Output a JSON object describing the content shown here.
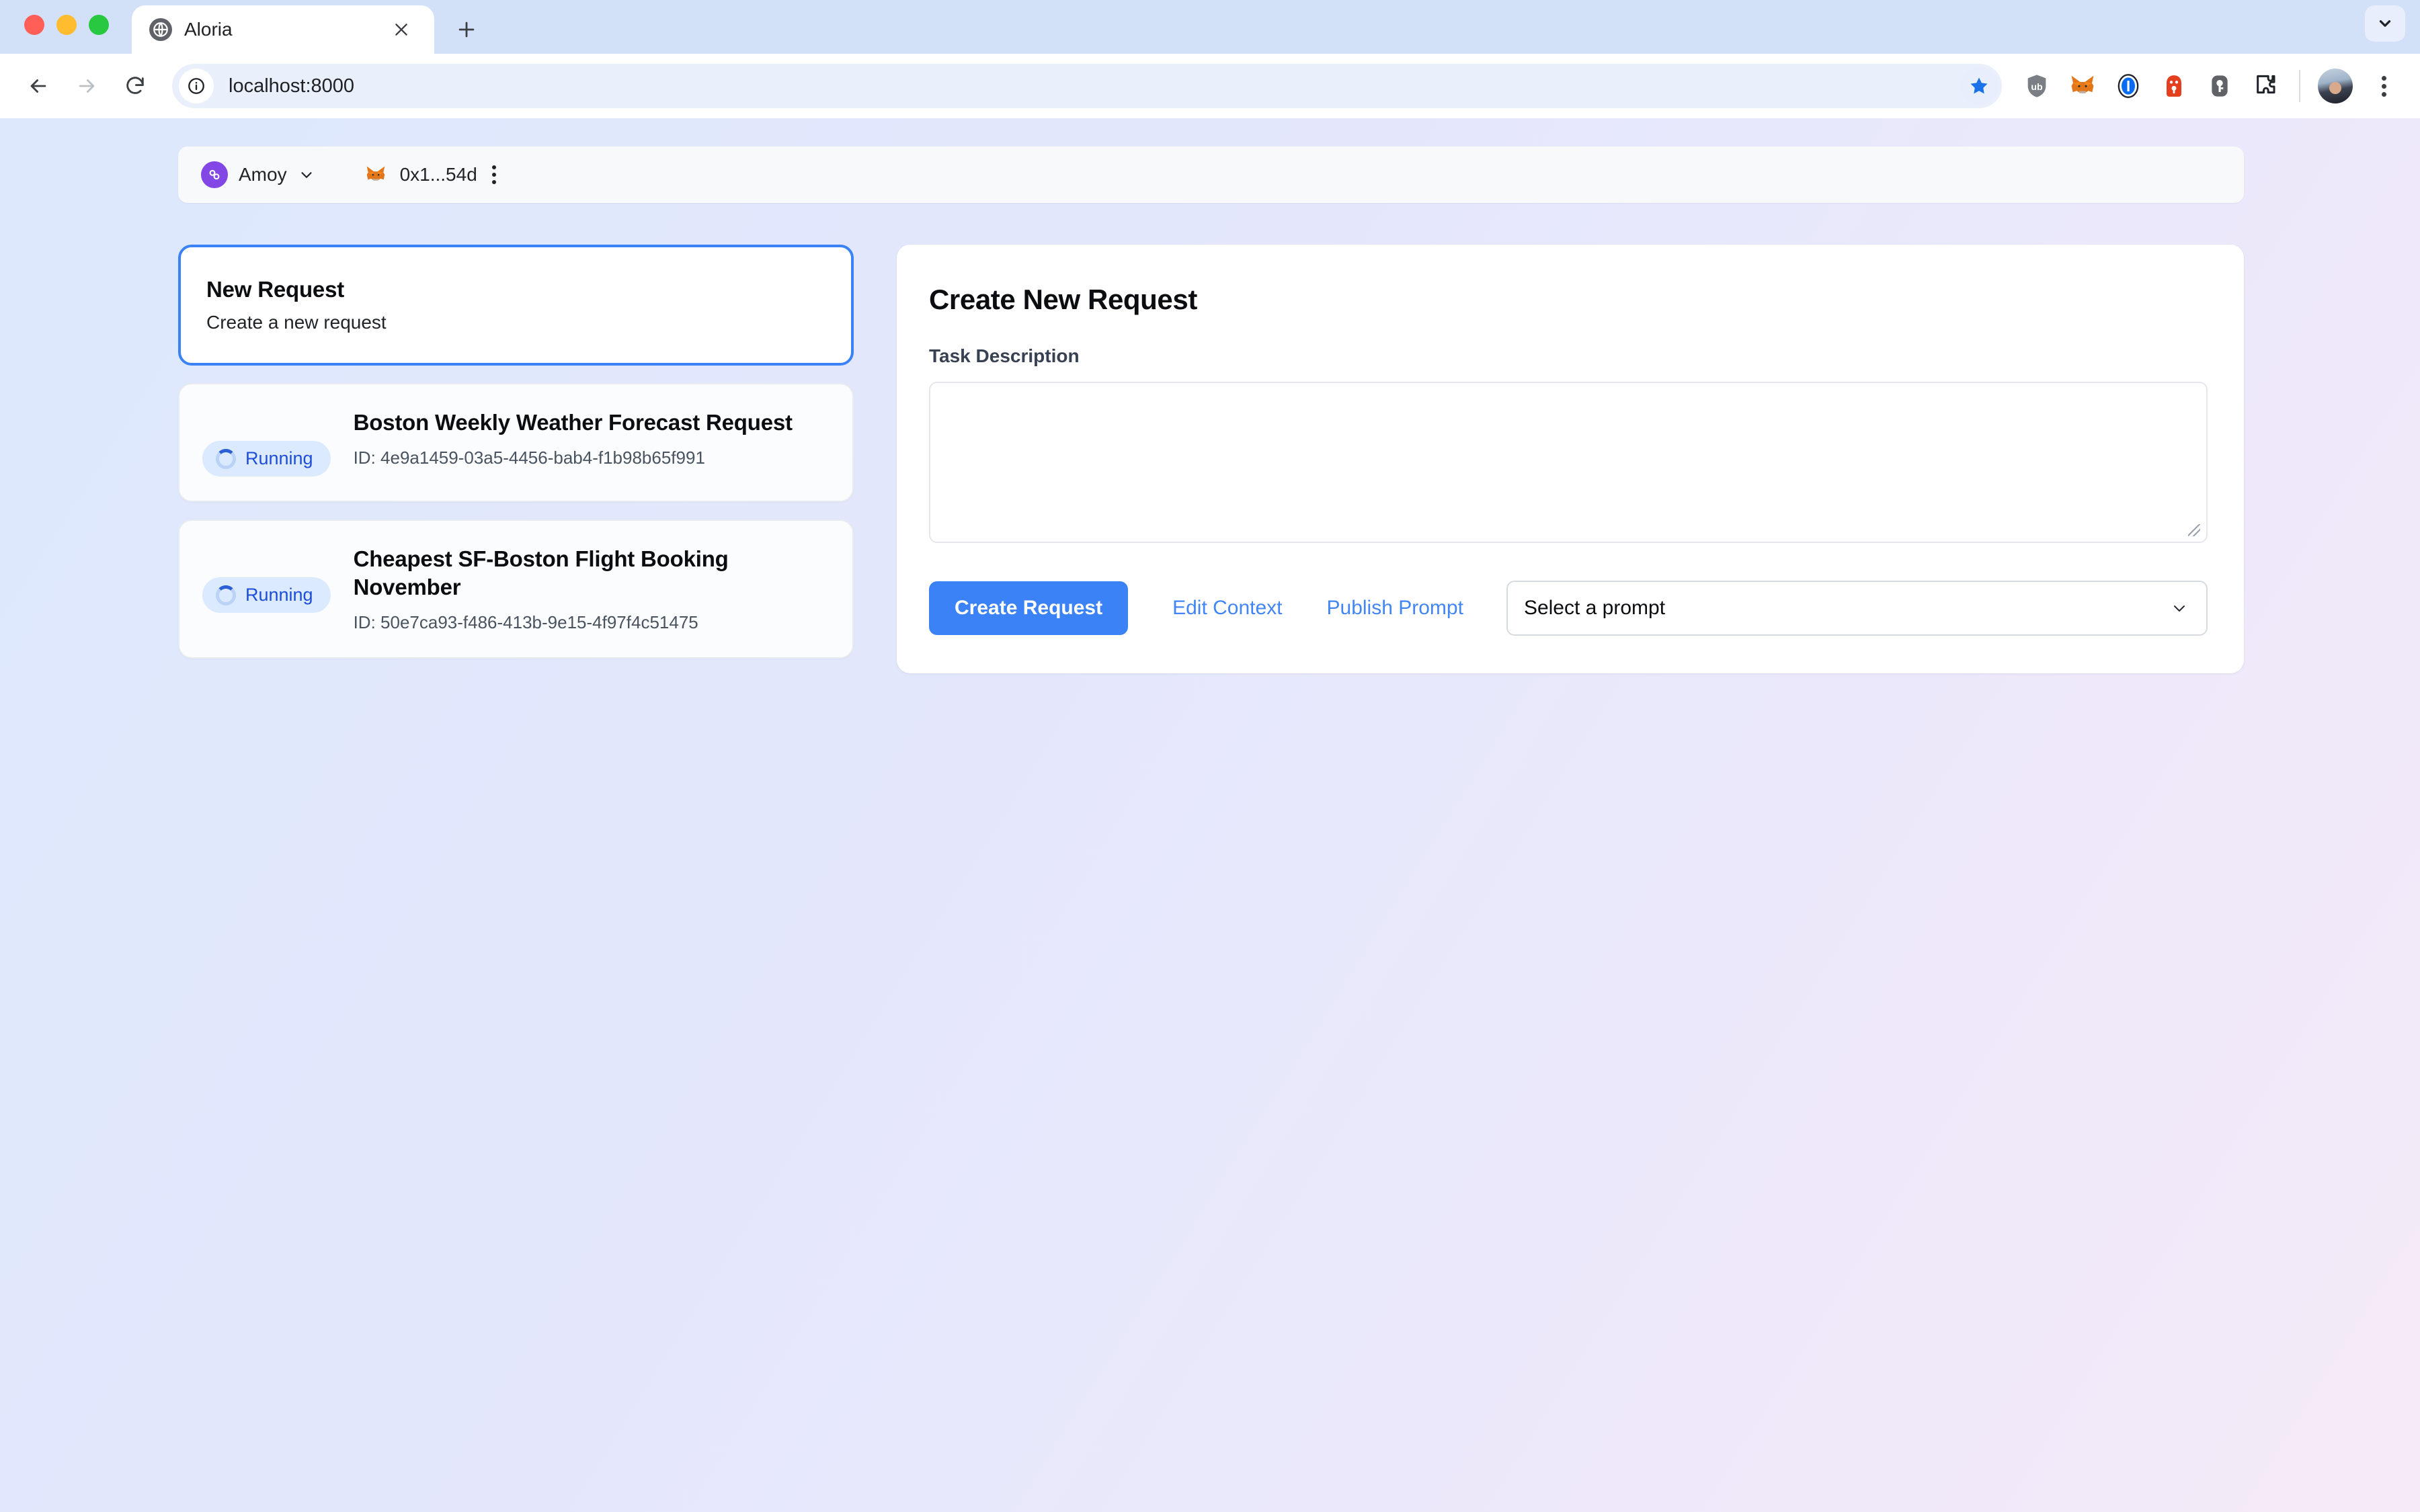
{
  "browser": {
    "tab": {
      "title": "Aloria",
      "favicon_icon": "globe-icon",
      "close_icon": "close-icon"
    },
    "newtab_icon": "plus-icon",
    "tabsearch_icon": "chevron-down-icon",
    "nav": {
      "back_icon": "arrow-left-icon",
      "forward_icon": "arrow-right-icon",
      "reload_icon": "reload-icon"
    },
    "omnibox": {
      "url": "localhost:8000",
      "info_icon": "info-circle-icon",
      "bookmark_icon": "star-icon"
    },
    "extensions": [
      {
        "name": "ublock-origin-icon"
      },
      {
        "name": "metamask-fox-icon"
      },
      {
        "name": "onepassword-icon"
      },
      {
        "name": "private-internet-access-icon"
      },
      {
        "name": "password-key-icon"
      },
      {
        "name": "extensions-puzzle-icon"
      }
    ],
    "profile_icon": "avatar",
    "menu_icon": "kebab-menu-icon"
  },
  "wallet_bar": {
    "chain": {
      "name": "Amoy",
      "icon": "polygon-icon",
      "chevron_icon": "chevron-down-icon"
    },
    "account": {
      "address": "0x1...54d",
      "icon": "metamask-fox-icon"
    },
    "menu_icon": "kebab-menu-icon"
  },
  "sidebar": {
    "new_request": {
      "title": "New Request",
      "subtitle": "Create a new request",
      "selected": true
    },
    "requests": [
      {
        "status": "Running",
        "status_icon": "spinner-icon",
        "title": "Boston Weekly Weather Forecast Request",
        "id_label": "ID: 4e9a1459-03a5-4456-bab4-f1b98b65f991"
      },
      {
        "status": "Running",
        "status_icon": "spinner-icon",
        "title": "Cheapest SF-Boston Flight Booking November",
        "id_label": "ID: 50e7ca93-f486-413b-9e15-4f97f4c51475"
      }
    ]
  },
  "main_panel": {
    "title": "Create New Request",
    "task_description_label": "Task Description",
    "task_description_value": "",
    "task_description_placeholder": "",
    "create_button": "Create Request",
    "edit_context_link": "Edit Context",
    "publish_prompt_link": "Publish Prompt",
    "prompt_select": {
      "selected": "Select a prompt",
      "chevron_icon": "chevron-down-icon"
    }
  },
  "colors": {
    "accent_blue": "#3b82f6",
    "link_blue": "#4285f4",
    "badge_bg": "#dbeafe",
    "badge_text": "#1d4ed8",
    "polygon_purple": "#8247e5",
    "page_gradient_start": "#dde8fd",
    "page_gradient_end": "#f5eaf8"
  }
}
